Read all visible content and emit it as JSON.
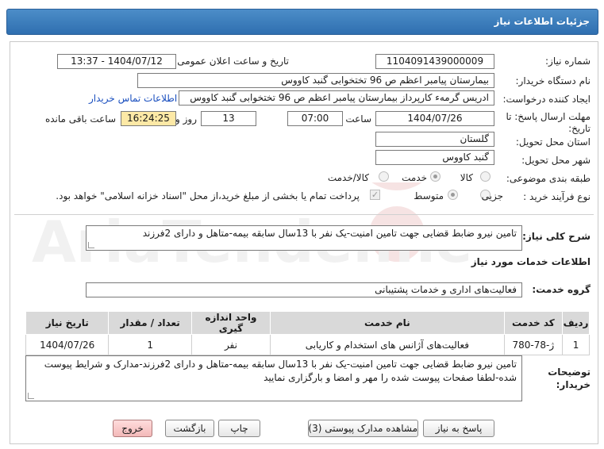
{
  "header": {
    "title": "جزئیات اطلاعات نیاز"
  },
  "fields": {
    "need_number_label": "شماره نیاز:",
    "need_number": "1104091439000009",
    "announce_label": "تاریخ و ساعت اعلان عمومی:",
    "announce_value": "1404/07/12 - 13:37",
    "buyer_org_label": "نام دستگاه خریدار:",
    "buyer_org": "بیمارستان پیامبر اعظم  ص  96 تختخوابی گنبد کاووس",
    "creator_label": "ایجاد کننده درخواست:",
    "creator": "ادریس گرمه‌ء کارپرداز بیمارستان پیامبر اعظم  ص  96 تختخوابی گنبد کاووس",
    "contact_link": "اطلاعات تماس خریدار",
    "deadline_label_1": "مهلت ارسال پاسخ: تا",
    "deadline_label_2": "تاریخ:",
    "deadline_date": "1404/07/26",
    "time_label": "ساعت",
    "deadline_time": "07:00",
    "days_value": "13",
    "days_label": "روز و",
    "remaining_time": "16:24:25",
    "remaining_label": "ساعت باقی مانده",
    "province_label": "استان محل تحویل:",
    "province": "گلستان",
    "city_label": "شهر محل تحویل:",
    "city": "گنبد کاووس",
    "category_label": "طبقه بندی موضوعی:",
    "category_options": [
      "کالا",
      "خدمت",
      "کالا/خدمت"
    ],
    "process_label": "نوع فرآیند خرید :",
    "process_options": [
      "جزیی",
      "متوسط"
    ],
    "payment_note": "پرداخت تمام یا بخشی از مبلغ خرید،از محل \"اسناد خزانه اسلامی\" خواهد بود."
  },
  "description": {
    "label": "شرح کلی نیاز:",
    "text": "تامین نیرو ضابط قضایی جهت تامین امنیت-یک نفر با 13سال سابقه بیمه-متاهل و دارای 2فرزند"
  },
  "services": {
    "section_title": "اطلاعات خدمات مورد نیاز",
    "group_label": "گروه خدمت:",
    "group_value": "فعالیت‌های اداری و خدمات پشتیبانی",
    "columns": [
      "ردیف",
      "کد خدمت",
      "نام خدمت",
      "واحد اندازه گیری",
      "تعداد / مقدار",
      "تاریخ نیاز"
    ],
    "rows": [
      [
        "1",
        "ژ-78-780",
        "فعالیت‌های آژانس های استخدام و کاریابی",
        "نفر",
        "1",
        "1404/07/26"
      ]
    ]
  },
  "buyer_notes": {
    "label_1": "توضیحات",
    "label_2": "خریدار:",
    "text": "تامین نیرو ضابط قضایی جهت تامین امنیت-یک نفر با 13سال سابقه بیمه-متاهل و دارای 2فرزند-مدارک و شرایط پیوست شده-لطفا صفحات پیوست شده را مهر و امضا و بارگزاری نمایید"
  },
  "buttons": {
    "reply": "پاسخ به نیاز",
    "attachments": "مشاهده مدارک پیوستی (3)",
    "print": "چاپ",
    "back": "بازگشت",
    "exit": "خروج"
  },
  "watermark": {
    "text": "AriaTender.neT"
  },
  "colors": {
    "header": "#3a7dbf",
    "yellow_box": "#fde9a6",
    "link": "#1a4fbf",
    "exit_btn": "#f3b9b9"
  }
}
